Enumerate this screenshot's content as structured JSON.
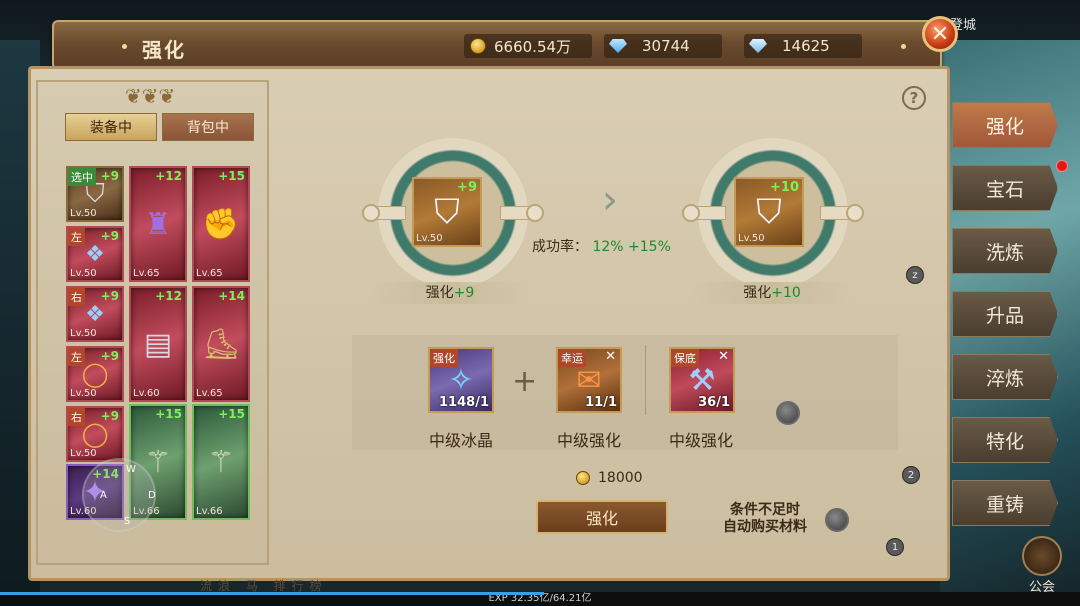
{
  "window": {
    "title": "强化"
  },
  "resources": {
    "gold": "6660.54万",
    "diamond": "30744",
    "bound_diamond": "14625"
  },
  "left_panel": {
    "tabs": [
      {
        "label": "装备中",
        "active": true
      },
      {
        "label": "背包中",
        "active": false
      }
    ],
    "items": [
      {
        "level": "Lv.50",
        "plus": "+9",
        "tag": "选中",
        "icon": "shield-icon"
      },
      {
        "level": "Lv.65",
        "plus": "+12",
        "tag": "",
        "icon": "armor-icon"
      },
      {
        "level": "Lv.65",
        "plus": "+15",
        "tag": "",
        "icon": "gauntlet-icon"
      },
      {
        "level": "Lv.50",
        "plus": "+9",
        "tag": "左",
        "icon": "earring-icon"
      },
      {
        "level": "Lv.50",
        "plus": "+9",
        "tag": "右",
        "icon": "earring-icon"
      },
      {
        "level": "Lv.60",
        "plus": "+12",
        "tag": "",
        "icon": "bracer-icon"
      },
      {
        "level": "Lv.65",
        "plus": "+14",
        "tag": "",
        "icon": "boots-icon"
      },
      {
        "level": "Lv.50",
        "plus": "+9",
        "tag": "左",
        "icon": "ring-icon"
      },
      {
        "level": "Lv.50",
        "plus": "+9",
        "tag": "右",
        "icon": "ring-icon"
      },
      {
        "level": "Lv.66",
        "plus": "+15",
        "tag": "",
        "icon": "spear-icon"
      },
      {
        "level": "Lv.66",
        "plus": "+15",
        "tag": "",
        "icon": "spear-icon"
      },
      {
        "level": "Lv.60",
        "plus": "+14",
        "tag": "",
        "icon": "claw-icon"
      }
    ]
  },
  "enhance": {
    "current": {
      "level": "Lv.50",
      "plus": "+9",
      "label_prefix": "强化",
      "label_value": "+9"
    },
    "next": {
      "level": "Lv.50",
      "plus": "+10",
      "label_prefix": "强化",
      "label_value": "+10"
    },
    "rate_label": "成功率：",
    "rate_value": "12% +15%",
    "materials": [
      {
        "tag": "强化",
        "count": "1148/1",
        "name": "中级冰晶",
        "icon": "ice-crystal-icon",
        "removable": false
      },
      {
        "tag": "幸运",
        "count": "11/1",
        "name": "中级强化",
        "icon": "scroll-icon",
        "removable": true
      },
      {
        "tag": "保底",
        "count": "36/1",
        "name": "中级强化",
        "icon": "hammer-icon",
        "removable": true
      }
    ],
    "cost": "18000",
    "button_label": "强化",
    "auto_buy_label_1": "条件不足时",
    "auto_buy_label_2": "自动购买材料"
  },
  "side_menu": [
    "强化",
    "宝石",
    "洗炼",
    "升品",
    "淬炼",
    "特化",
    "重铸"
  ],
  "guild_label": "公会",
  "exp_text": "EXP 32.35亿/64.21亿",
  "exp_fraction": 0.504,
  "joystick_labels": [
    "W",
    "A",
    "D",
    "S"
  ],
  "mini_badges": [
    "z",
    "2",
    "1"
  ],
  "help_label": "?",
  "close_label": "✕",
  "background_text": {
    "top_right": "登城",
    "bottom": "流浪 马 排行榜"
  },
  "colors": {
    "green_value": "#1f8a2a",
    "gold": "#d4a12a",
    "accent_red": "#a0583a"
  }
}
